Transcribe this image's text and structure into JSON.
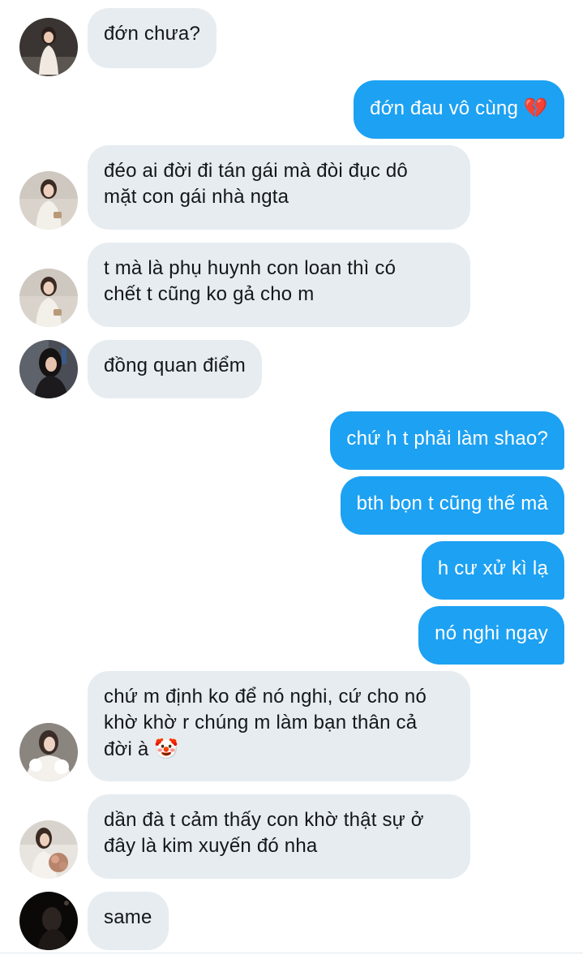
{
  "messages": [
    {
      "side": "in",
      "avatar": "avatar-girl-white-outfit",
      "lines": [
        "đớn chưa?"
      ]
    },
    {
      "side": "out",
      "lines": [
        "đớn đau vô cùng"
      ],
      "emoji": "💔",
      "emoji_name": "broken-heart-icon"
    },
    {
      "side": "in",
      "avatar": "avatar-girl-sweater",
      "lines": [
        "đéo ai đời đi tán gái mà đòi đục dô",
        "mặt con gái nhà ngta"
      ]
    },
    {
      "side": "in",
      "avatar": "avatar-girl-sweater",
      "lines": [
        "t mà là phụ huynh con loan thì có",
        "chết t cũng ko gả cho m"
      ]
    },
    {
      "side": "in",
      "avatar": "avatar-girl-dark-hair",
      "lines": [
        "đồng quan điểm"
      ]
    },
    {
      "side": "out",
      "lines": [
        "chứ h t phải làm shao?"
      ]
    },
    {
      "side": "out",
      "lines": [
        "bth bọn t cũng thế mà"
      ]
    },
    {
      "side": "out",
      "lines": [
        "h cư xử kì lạ"
      ]
    },
    {
      "side": "out",
      "lines": [
        "nó nghi ngay"
      ]
    },
    {
      "side": "in",
      "avatar": "avatar-girl-fur-coat",
      "lines": [
        "chứ m định ko để nó nghi, cứ cho nó",
        "khờ khờ r chúng m làm bạn thân cả",
        "đời à"
      ],
      "emoji": "🤡",
      "emoji_name": "clown-face-icon"
    },
    {
      "side": "in",
      "avatar": "avatar-girl-flowers",
      "lines": [
        "dần đà t cảm thấy con khờ thật sự ở",
        "đây là kim xuyến đó nha"
      ]
    },
    {
      "side": "in",
      "avatar": "avatar-silhouette",
      "lines": [
        "same"
      ]
    }
  ],
  "colors": {
    "incoming_bubble": "#e6ecf0",
    "outgoing_bubble": "#1da1f2",
    "incoming_text": "#14171a",
    "outgoing_text": "#ffffff"
  }
}
